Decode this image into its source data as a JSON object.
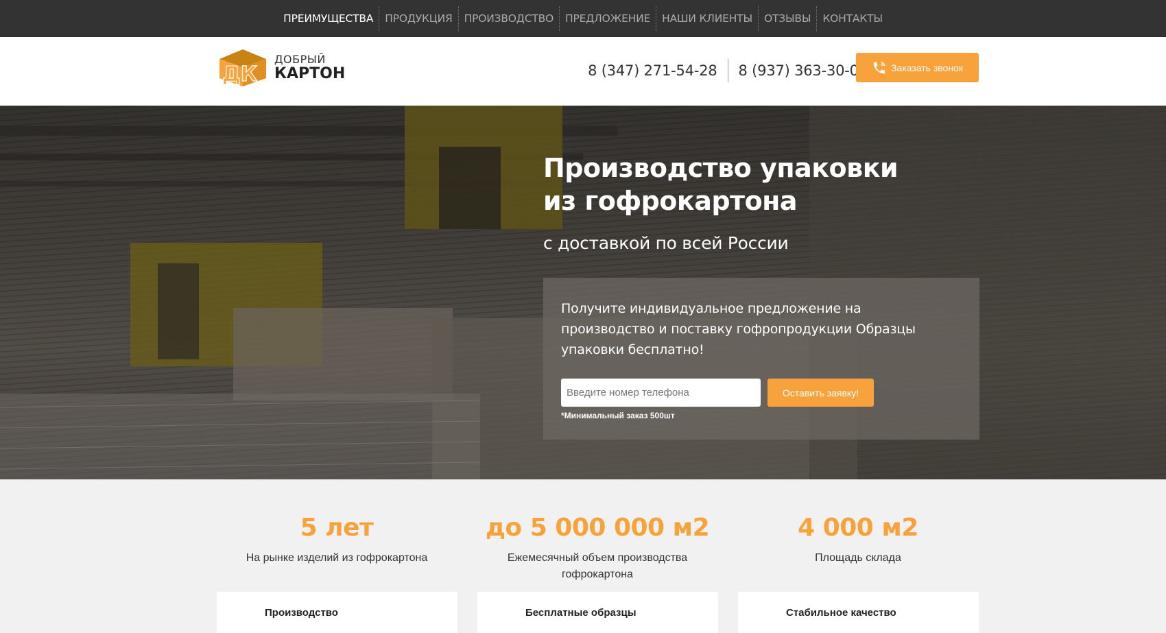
{
  "topnav": {
    "items": [
      {
        "label": "ПРЕИМУЩЕСТВА"
      },
      {
        "label": "ПРОДУКЦИЯ"
      },
      {
        "label": "ПРОИЗВОДСТВО"
      },
      {
        "label": "ПРЕДЛОЖЕНИЕ"
      },
      {
        "label": "НАШИ КЛИЕНТЫ"
      },
      {
        "label": "ОТЗЫВЫ"
      },
      {
        "label": "КОНТАКТЫ"
      }
    ]
  },
  "header": {
    "logo": {
      "mark": "ДК",
      "line1": "ДОБРЫЙ",
      "line2": "КАРТОН"
    },
    "phones": [
      "8 (347) 271-54-28",
      "8 (937) 363-30-00"
    ],
    "call_button": "Заказать звонок",
    "call_icon": "phone-icon"
  },
  "hero": {
    "title": "Производство упаковки из гофрокартона",
    "subtitle": "с доставкой по всей России",
    "offer_text": "Получите индивидуальное предложение на производство и поставку гофропродукции Образцы упаковки бесплатно!",
    "phone_placeholder": "Введите номер телефона",
    "submit_label": "Оставить заявку!",
    "note": "*Минимальный заказ 500шт"
  },
  "stats": [
    {
      "value": "5 лет",
      "desc": "На рынке изделий из гофрокартона"
    },
    {
      "value": "до 5 000 000 м2",
      "desc": "Ежемесячный объем производства гофрокартона"
    },
    {
      "value": "4 000 м2",
      "desc": "Площадь склада"
    }
  ],
  "cards": [
    {
      "title": "Производство"
    },
    {
      "title": "Бесплатные образцы"
    },
    {
      "title": "Стабильное качество"
    }
  ],
  "colors": {
    "accent": "#f8a23b",
    "nav_bg": "#333333",
    "nav_active": "#ffffff",
    "nav_text": "#a9a9a9"
  }
}
